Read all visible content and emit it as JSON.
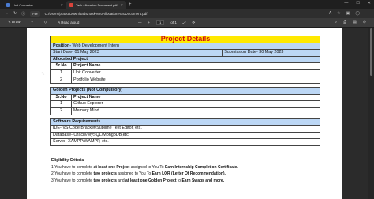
{
  "browser": {
    "tabs": [
      {
        "label": "Unit Converter"
      },
      {
        "label": "Task Allocation Document.pdf"
      }
    ],
    "new_tab": "+",
    "address": {
      "file_chip": "File",
      "url": "C:/Users/prabu/Downloads/Task%20Allocation%20Document.pdf"
    }
  },
  "pdf_toolbar": {
    "draw": "Draw",
    "read_aloud": "Read aloud",
    "page_current": "1",
    "page_total": "of 1",
    "zoom_out": "—",
    "zoom_in": "+"
  },
  "document": {
    "title": "Project Details",
    "position": {
      "label": "Position-",
      "value": " Web Development Intern"
    },
    "start_date": "Start Date- 01 May 2023",
    "submission_date": "Submission Date- 30 May 2023",
    "allocated_header": "Allocated Project",
    "allocated_cols": {
      "no": "Sr.No",
      "name": "Project Name"
    },
    "allocated_rows": [
      {
        "no": "1",
        "name": "Unit Converter"
      },
      {
        "no": "2",
        "name": "Portfolio Website"
      }
    ],
    "golden_header": "Golden Projects (Not Compulsory)",
    "golden_cols": {
      "no": "Sr.No",
      "name": "Project Name"
    },
    "golden_rows": [
      {
        "no": "1",
        "name": "Github Explorer"
      },
      {
        "no": "2",
        "name": "Memory Mind"
      }
    ],
    "software_header": "Software Requirements",
    "software_lines": [
      "IDE- VS Code/Bracket/Sublime Text Editor, etc.",
      "Database- Oracle/MySQL/MongoDB,etc.",
      "Server- XAMPP/WAMPP, etc."
    ],
    "criteria": {
      "heading": "Eligibility Criteria",
      "line1_a": "1.You have to complete ",
      "line1_b": "at least one Project",
      "line1_c": " assigned to You To ",
      "line1_d": "Earn Internship Completion Certificate.",
      "line2_a": "2.You have to complete ",
      "line2_b": "two projects",
      "line2_c": " assigned to You To ",
      "line2_d": "Earn LOR (Letter Of Recommendation).",
      "line3_a": "3.You have to complete ",
      "line3_b": "two projects",
      "line3_c": " and ",
      "line3_d": "at least one Golden Project",
      "line3_e": " to ",
      "line3_f": "Earn Swags and more."
    }
  }
}
